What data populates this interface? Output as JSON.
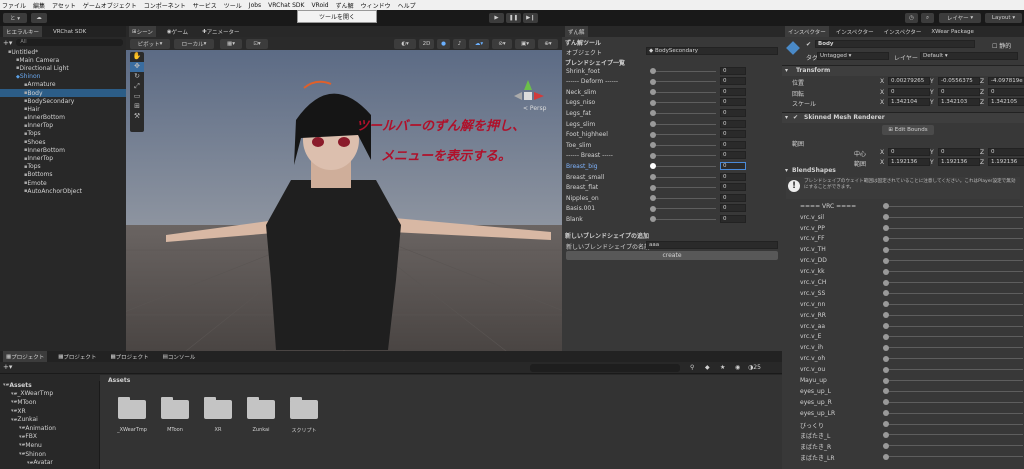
{
  "menubar": [
    "ファイル",
    "編集",
    "アセット",
    "ゲームオブジェクト",
    "コンポーネント",
    "サービス",
    "ツール",
    "Jobs",
    "VRChat SDK",
    "VRoid",
    "ずん解",
    "ウィンドウ",
    "ヘルプ"
  ],
  "tooltip": "ツールを開く",
  "toolbar": {
    "account": "と ▾",
    "layers": "レイヤー",
    "layout": "Layout"
  },
  "hierarchy": {
    "tabs": [
      "ヒエラルキー",
      "VRChat SDK"
    ],
    "search_placeholder": "All",
    "rows": [
      {
        "t": "Untitled*",
        "ind": 1,
        "sel": false,
        "blue": false
      },
      {
        "t": "Main Camera",
        "ind": 2,
        "sel": false,
        "blue": false
      },
      {
        "t": "Directional Light",
        "ind": 2,
        "sel": false,
        "blue": false
      },
      {
        "t": "Shinon",
        "ind": 2,
        "sel": false,
        "blue": true
      },
      {
        "t": "Armature",
        "ind": 3,
        "sel": false,
        "blue": false
      },
      {
        "t": "Body",
        "ind": 3,
        "sel": true,
        "blue": false
      },
      {
        "t": "BodySecondary",
        "ind": 3,
        "sel": false,
        "blue": false
      },
      {
        "t": "Hair",
        "ind": 3,
        "sel": false,
        "blue": false
      },
      {
        "t": "InnerBottom",
        "ind": 3,
        "sel": false,
        "blue": false
      },
      {
        "t": "InnerTop",
        "ind": 3,
        "sel": false,
        "blue": false
      },
      {
        "t": "Tops",
        "ind": 3,
        "sel": false,
        "blue": false
      },
      {
        "t": "Shoes",
        "ind": 3,
        "sel": false,
        "blue": false
      },
      {
        "t": "InnerBottom",
        "ind": 3,
        "sel": false,
        "blue": false
      },
      {
        "t": "InnerTop",
        "ind": 3,
        "sel": false,
        "blue": false
      },
      {
        "t": "Tops",
        "ind": 3,
        "sel": false,
        "blue": false
      },
      {
        "t": "Bottoms",
        "ind": 3,
        "sel": false,
        "blue": false
      },
      {
        "t": "Emote",
        "ind": 3,
        "sel": false,
        "blue": false
      },
      {
        "t": "AutoAnchorObject",
        "ind": 3,
        "sel": false,
        "blue": false
      }
    ]
  },
  "scene": {
    "tabs": [
      "シーン",
      "ゲーム",
      "アニメーター"
    ],
    "pivot": "ピボット",
    "local": "ローカル",
    "mode2d": "2D",
    "overlay_text": [
      "ツールバーのずん解を押し、",
      "メニューを表示する。"
    ],
    "persp": "< Persp"
  },
  "editor": {
    "tab": "ずん解",
    "title": "ずん解ツール",
    "object_label": "オブジェクト",
    "object_value": "BodySecondary",
    "list_title": "ブレンドシェイプ一覧",
    "shapes": [
      {
        "n": "Shrink_foot",
        "v": 0,
        "hi": false
      },
      {
        "n": "------ Deform ------",
        "v": 0,
        "hi": false
      },
      {
        "n": "Neck_slim",
        "v": 0,
        "hi": false
      },
      {
        "n": "Legs_niso",
        "v": 0,
        "hi": false
      },
      {
        "n": "Legs_fat",
        "v": 0,
        "hi": false
      },
      {
        "n": "Legs_slim",
        "v": 0,
        "hi": false
      },
      {
        "n": "Foot_highheel",
        "v": 0,
        "hi": false
      },
      {
        "n": "Toe_slim",
        "v": 0,
        "hi": false
      },
      {
        "n": "------ Breast -----",
        "v": 0,
        "hi": false
      },
      {
        "n": "Breast_big",
        "v": 0,
        "hi": true
      },
      {
        "n": "Breast_small",
        "v": 0,
        "hi": false
      },
      {
        "n": "Breast_flat",
        "v": 0,
        "hi": false
      },
      {
        "n": "Nipples_on",
        "v": 0,
        "hi": false
      },
      {
        "n": "Basis.001",
        "v": 0,
        "hi": false
      },
      {
        "n": "Blank",
        "v": 0,
        "hi": false
      }
    ],
    "add_title": "新しいブレンドシェイプの追加",
    "name_label": "新しいブレンドシェイプの名前",
    "name_value": "aaa",
    "create": "create"
  },
  "inspector": {
    "tabs": [
      "インスペクター",
      "インスペクター",
      "インスペクター",
      "XWear Package"
    ],
    "obj_name": "Body",
    "static": "静的",
    "tag_label": "タグ",
    "tag": "Untagged",
    "layer_label": "レイヤー",
    "layer": "Default",
    "transform": {
      "title": "Transform",
      "rows": [
        {
          "l": "位置",
          "x": "0.00279265",
          "y": "-0.0556375",
          "z": "-4.097819e"
        },
        {
          "l": "回転",
          "x": "0",
          "y": "0",
          "z": "0"
        },
        {
          "l": "スケール",
          "x": "1.342104",
          "y": "1.342103",
          "z": "1.342105"
        }
      ]
    },
    "smr": {
      "title": "Skinned Mesh Renderer",
      "edit_bounds": "Edit Bounds",
      "bounds_label": "範囲",
      "center_label": "中心",
      "center": [
        "0",
        "0",
        "0"
      ],
      "extent_label": "範囲",
      "extent": [
        "1.192136",
        "1.192136",
        "1.192136"
      ]
    },
    "blendshapes": {
      "title": "BlendShapes",
      "warning": "ブレンドシェイプのウェイト範囲は固定されていることに注意してください。これはPlayer設定で無効にすることができます。",
      "rows": [
        "==== VRC ====",
        "vrc.v_sil",
        "vrc.v_PP",
        "vrc.v_FF",
        "vrc.v_TH",
        "vrc.v_DD",
        "vrc.v_kk",
        "vrc.v_CH",
        "vrc.v_SS",
        "vrc.v_nn",
        "vrc.v_RR",
        "vrc.v_aa",
        "vrc.v_E",
        "vrc.v_ih",
        "vrc.v_oh",
        "vrc.v_ou",
        "Mayu_up",
        "eyes_up_L",
        "eyes_up_R",
        "eyes_up_LR",
        "びっくり",
        "まばたき_L",
        "まばたき_R",
        "まばたき_LR"
      ]
    }
  },
  "project": {
    "tabs": [
      "プロジェクト",
      "プロジェクト",
      "プロジェクト",
      "コンソール"
    ],
    "zoom": "25",
    "tree": [
      {
        "t": "Assets",
        "ind": 0
      },
      {
        "t": "_XWearTmp",
        "ind": 1
      },
      {
        "t": "MToon",
        "ind": 1
      },
      {
        "t": "XR",
        "ind": 1
      },
      {
        "t": "Zunkai",
        "ind": 1
      },
      {
        "t": "Animation",
        "ind": 2
      },
      {
        "t": "FBX",
        "ind": 2
      },
      {
        "t": "Menu",
        "ind": 2
      },
      {
        "t": "Shinon",
        "ind": 2
      },
      {
        "t": "Avatar",
        "ind": 3
      }
    ],
    "breadcrumb": "Assets",
    "folders": [
      "_XWearTmp",
      "MToon",
      "XR",
      "Zunkai",
      "スクリプト"
    ]
  }
}
